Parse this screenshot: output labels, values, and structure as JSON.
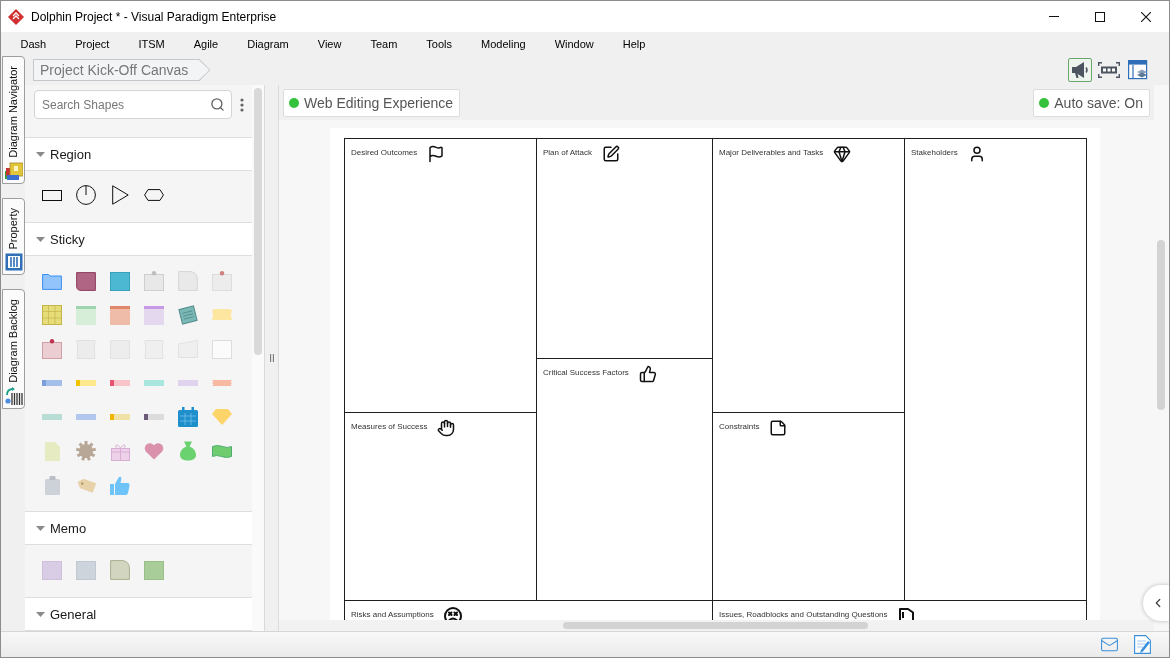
{
  "window": {
    "title": "Dolphin Project * - Visual Paradigm Enterprise"
  },
  "menu": [
    "Dash",
    "Project",
    "ITSM",
    "Agile",
    "Diagram",
    "View",
    "Team",
    "Tools",
    "Modeling",
    "Window",
    "Help"
  ],
  "side_tabs": [
    {
      "label": "Diagram Navigator",
      "kind": "navigator"
    },
    {
      "label": "Property",
      "kind": "property"
    },
    {
      "label": "Diagram Backlog",
      "kind": "backlog"
    }
  ],
  "breadcrumb": {
    "label": "Project Kick-Off Canvas"
  },
  "toolbar": [
    {
      "kind": "megaphone",
      "selected": true
    },
    {
      "kind": "frame",
      "selected": false
    },
    {
      "kind": "layers",
      "selected": false
    }
  ],
  "shape_panel": {
    "search": {
      "placeholder": "Search Shapes"
    },
    "sections": [
      {
        "title": "Region",
        "kind": "region",
        "expanded": true
      },
      {
        "title": "Sticky",
        "kind": "sticky",
        "expanded": true
      },
      {
        "title": "Memo",
        "kind": "memo",
        "expanded": true
      },
      {
        "title": "General",
        "kind": "general",
        "expanded": true
      }
    ]
  },
  "canvas": {
    "web_editing": {
      "label": "Web Editing Experience"
    },
    "auto_save": {
      "label": "Auto save: On"
    },
    "blocks": [
      {
        "title": "Desired Outcomes",
        "kind": "flag"
      },
      {
        "title": "Plan of Attack",
        "kind": "pen"
      },
      {
        "title": "Major Deliverables and Tasks",
        "kind": "gem"
      },
      {
        "title": "Stakeholders",
        "kind": "person"
      },
      {
        "title": "Critical Success Factors",
        "kind": "thumbs_up"
      },
      {
        "title": "Measures of Success",
        "kind": "hand"
      },
      {
        "title": "Constraints",
        "kind": "note"
      },
      {
        "title": "Risks and Assumptions",
        "kind": "face"
      },
      {
        "title": "Issues, Roadblocks and Outstanding Questions",
        "kind": "stone"
      }
    ]
  }
}
